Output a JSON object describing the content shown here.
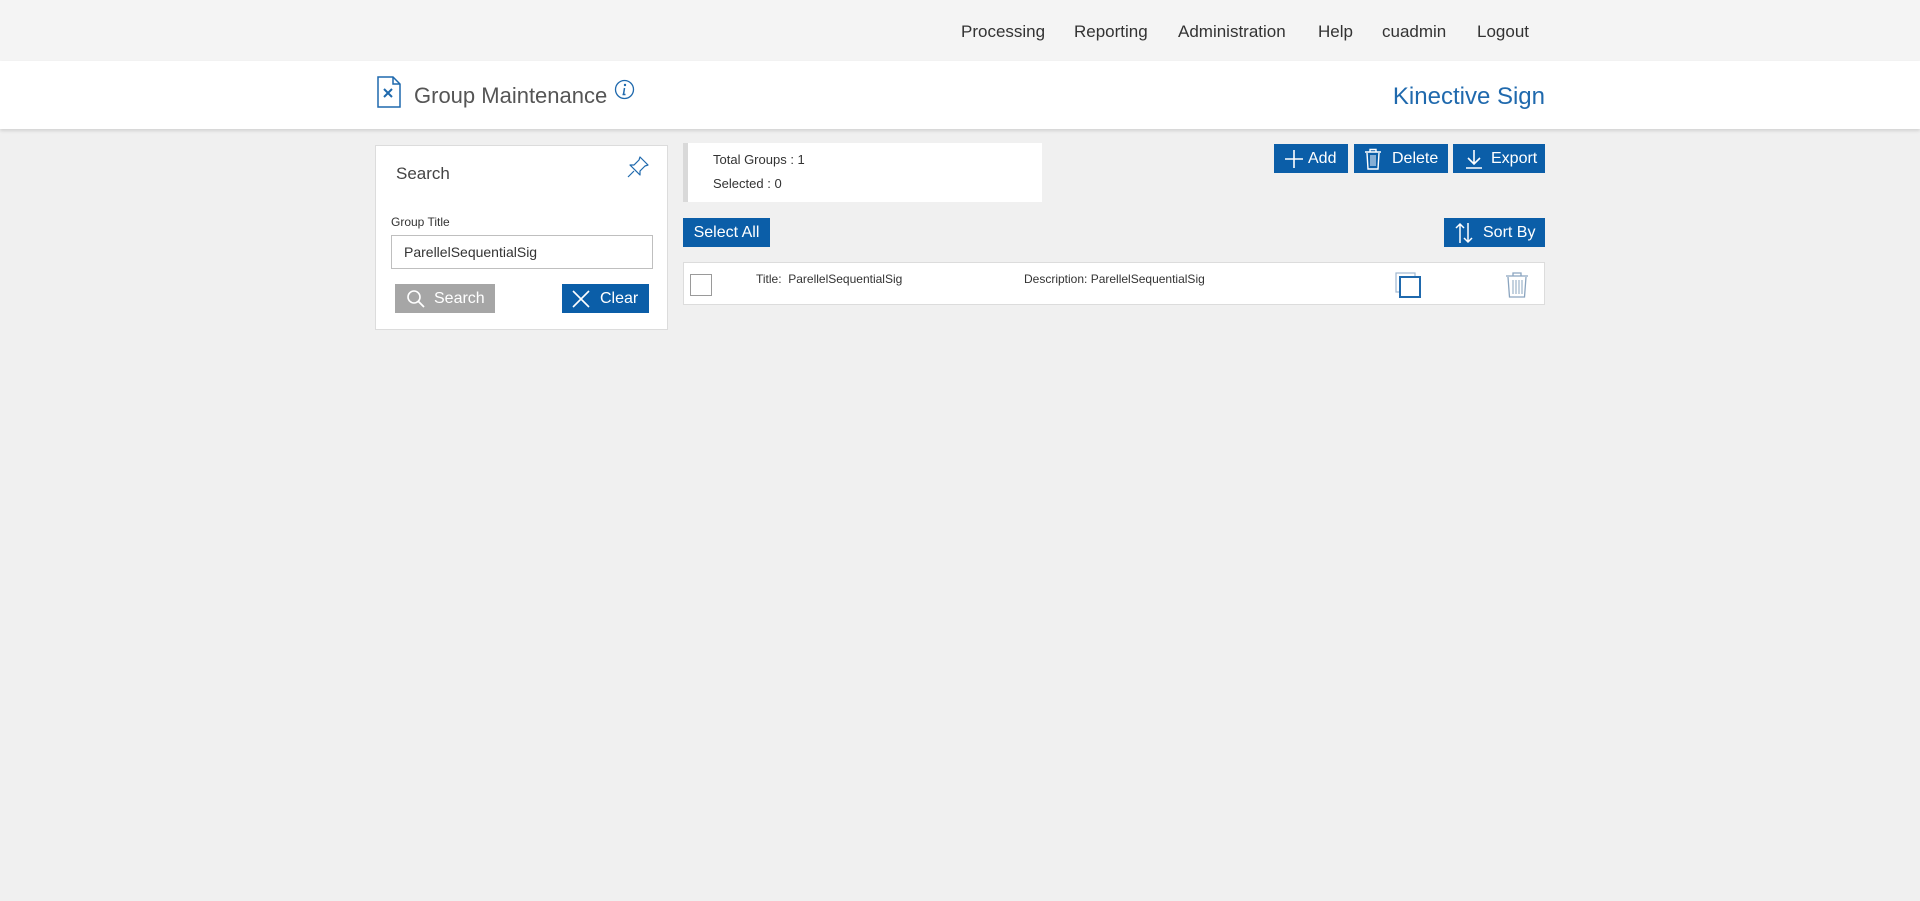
{
  "nav": {
    "processing": "Processing",
    "reporting": "Reporting",
    "administration": "Administration",
    "help": "Help",
    "user": "cuadmin",
    "logout": "Logout"
  },
  "header": {
    "page_icon": "document-x-icon",
    "title": "Group Maintenance",
    "info_icon": "info-icon",
    "brand": "Kinective Sign"
  },
  "search": {
    "title": "Search",
    "pin_icon": "pin-icon",
    "group_title_label": "Group Title",
    "group_title_value": "ParellelSequentialSig",
    "search_button": "Search",
    "clear_button": "Clear"
  },
  "summary": {
    "total_label": "Total Groups : ",
    "total_value": "1",
    "selected_label": "Selected : ",
    "selected_value": "0"
  },
  "toolbar": {
    "add": "Add",
    "delete": "Delete",
    "export": "Export",
    "select_all": "Select All",
    "sort_by": "Sort By"
  },
  "results": [
    {
      "title_label": "Title:",
      "title_value": "ParellelSequentialSig",
      "description_label": "Description:",
      "description_value": "ParellelSequentialSig"
    }
  ],
  "colors": {
    "accent": "#0b5ea8",
    "brand": "#1f69ad",
    "disabled_button": "#a6a6a6",
    "page_background": "#f0f0f0"
  }
}
